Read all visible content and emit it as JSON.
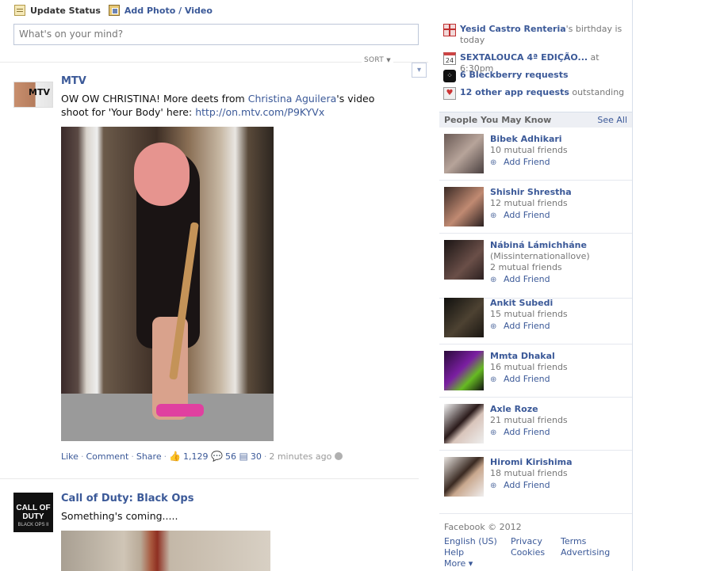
{
  "composer": {
    "tab_status": "Update Status",
    "tab_photo": "Add Photo / Video",
    "placeholder": "What's on your mind?"
  },
  "feed": {
    "sort_label": "SORT",
    "stories": [
      {
        "author": "MTV",
        "text_prefix": "OW OW CHRISTINA! More deets from ",
        "text_link": "Christina Aguilera",
        "text_middle": "'s video shoot for 'Your Body' here: ",
        "url": "http://on.mtv.com/P9KYVx",
        "like": "Like",
        "comment": "Comment",
        "share": "Share",
        "likes_count": "1,129",
        "comments_count": "56",
        "shares_count": "30",
        "time": "2 minutes ago"
      },
      {
        "author": "Call of Duty: Black Ops",
        "text": "Something's coming.....",
        "avatar_text": "CALL OF DUTY",
        "avatar_sub": "BLACK OPS II"
      }
    ]
  },
  "sidebar": {
    "reminders": [
      {
        "bold": "Yesid Castro Renteria",
        "rest": "'s birthday is today",
        "icon": "gift-icon"
      },
      {
        "bold": "SEXTALOUCA 4ª EDIÇÃO...",
        "rest": " at 6:30pm",
        "icon": "calendar-icon",
        "icon_text": "24"
      },
      {
        "bold": "6 Bleckberry requests",
        "rest": "",
        "icon": "blackberry-icon"
      },
      {
        "bold": "12 other app requests",
        "rest": " outstanding",
        "icon": "app-request-icon"
      }
    ],
    "pymk_title": "People You May Know",
    "see_all": "See All",
    "add_friend": "Add Friend",
    "people": [
      {
        "name": "Bibek Adhikari",
        "mutual": "10 mutual friends"
      },
      {
        "name": "Shishir Shrestha",
        "mutual": "12 mutual friends"
      },
      {
        "name": "Nábiná Lámichháne",
        "sub": "(Missinternationallove)",
        "mutual": "2 mutual friends"
      },
      {
        "name": "Ankit Subedi",
        "mutual": "15 mutual friends"
      },
      {
        "name": "Mmta Dhakal",
        "mutual": "16 mutual friends"
      },
      {
        "name": "Axle Roze",
        "mutual": "21 mutual friends"
      },
      {
        "name": "Hiromi Kirishima",
        "mutual": "18 mutual friends"
      }
    ],
    "footer": {
      "copyright": "Facebook © 2012",
      "links": [
        "English (US)",
        "Privacy",
        "Terms",
        "Help",
        "Cookies",
        "Advertising",
        "More ▾"
      ]
    }
  },
  "colors": {
    "link": "#3b5998",
    "muted": "#777777",
    "border": "#d8dfea"
  }
}
